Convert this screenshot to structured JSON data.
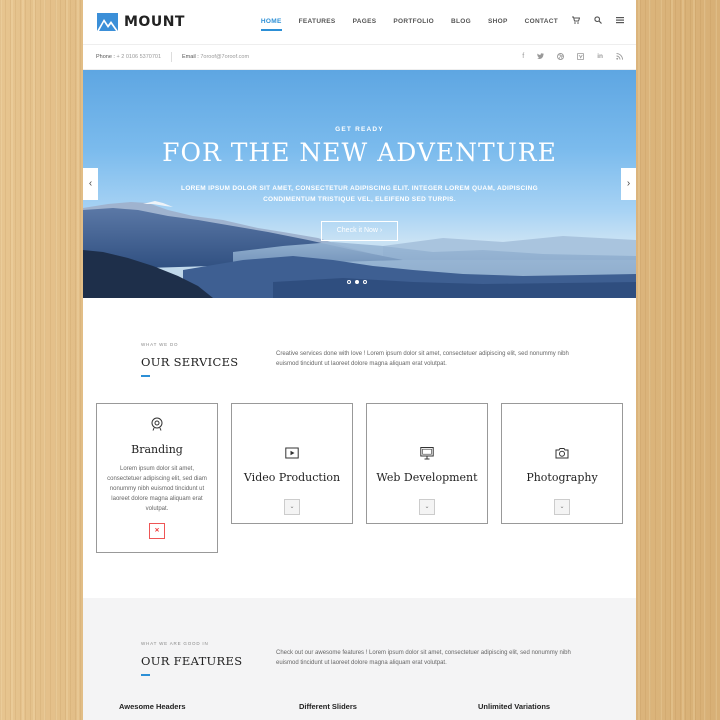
{
  "brand": {
    "name": "MOUNT",
    "accent": "#2c8fd6"
  },
  "nav": {
    "items": [
      "HOME",
      "FEATURES",
      "PAGES",
      "PORTFOLIO",
      "BLOG",
      "SHOP",
      "CONTACT"
    ],
    "active": "HOME",
    "icons": [
      "cart-icon",
      "search-icon",
      "menu-icon"
    ]
  },
  "infobar": {
    "phone_label": "Phone :",
    "phone": "+ 2 0106 5370701",
    "email_label": "Email :",
    "email": "7oroof@7oroof.com",
    "social": [
      "facebook-icon",
      "twitter-icon",
      "dribbble-icon",
      "vimeo-icon",
      "linkedin-icon",
      "rss-icon"
    ]
  },
  "hero": {
    "kicker": "GET READY",
    "title": "FOR THE NEW ADVENTURE",
    "lead": "LOREM IPSUM DOLOR SIT AMET, CONSECTETUR ADIPISCING ELIT. INTEGER LOREM QUAM, ADIPISCING CONDIMENTUM TRISTIQUE VEL, ELEIFEND SED TURPIS.",
    "button": "Check it Now",
    "slides": 3,
    "active_slide": 2
  },
  "services": {
    "label": "WHAT WE DO",
    "title": "OUR SERVICES",
    "desc": "Creative services done with love ! Lorem ipsum dolor sit amet, consectetuer adipiscing elit, sed nonummy nibh euismod tincidunt ut laoreet dolore magna aliquam erat volutpat.",
    "cards": [
      {
        "title": "Branding",
        "icon": "branding-icon",
        "text": "Lorem ipsum dolor sit amet, consectetuer adipiscing elit, sed diam nonummy nibh euismod tincidunt ut laoreet dolore magna aliquam erat volutpat.",
        "expanded": true
      },
      {
        "title": "Video Production",
        "icon": "video-icon",
        "expanded": false
      },
      {
        "title": "Web Development",
        "icon": "monitor-icon",
        "expanded": false
      },
      {
        "title": "Photography",
        "icon": "camera-icon",
        "expanded": false
      }
    ]
  },
  "features": {
    "label": "WHAT WE ARE GOOD IN",
    "title": "OUR FEATURES",
    "desc": "Check out our awesome features ! Lorem ipsum dolor sit amet, consectetuer adipiscing elit, sed nonummy nibh euismod tincidunt ut laoreet dolore magna aliquam erat volutpat.",
    "columns": [
      "Awesome Headers",
      "Different Sliders",
      "Unlimited Variations"
    ]
  }
}
